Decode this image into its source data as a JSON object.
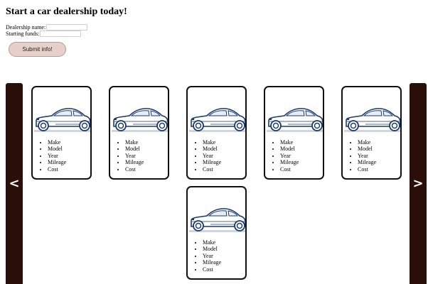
{
  "header": {
    "title": "Start a car dealership today!"
  },
  "form": {
    "dealership_label": "Dealership name:",
    "funds_label": "Starting funds:",
    "dealership_value": "",
    "funds_value": "",
    "submit_label": "Submit info!"
  },
  "carousel": {
    "prev_label": "<",
    "next_label": ">",
    "cards": [
      {
        "fields": [
          "Make",
          "Model",
          "Year",
          "Mileage",
          "Cost"
        ]
      },
      {
        "fields": [
          "Make",
          "Model",
          "Year",
          "Mileage",
          "Cost"
        ]
      },
      {
        "fields": [
          "Make",
          "Model",
          "Year",
          "Mileage",
          "Cost"
        ]
      },
      {
        "fields": [
          "Make",
          "Model",
          "Year",
          "Mileage",
          "Cost"
        ]
      },
      {
        "fields": [
          "Make",
          "Model",
          "Year",
          "Mileage",
          "Cost"
        ]
      },
      {
        "fields": [
          "Make",
          "Model",
          "Year",
          "Mileage",
          "Cost"
        ]
      }
    ]
  },
  "colors": {
    "nav_bg": "#2a0e08",
    "button_bg": "#e8d0ca",
    "car_outline": "#1b3a6b",
    "card_border": "#111111"
  },
  "icons": {
    "card_image": "car-icon"
  }
}
